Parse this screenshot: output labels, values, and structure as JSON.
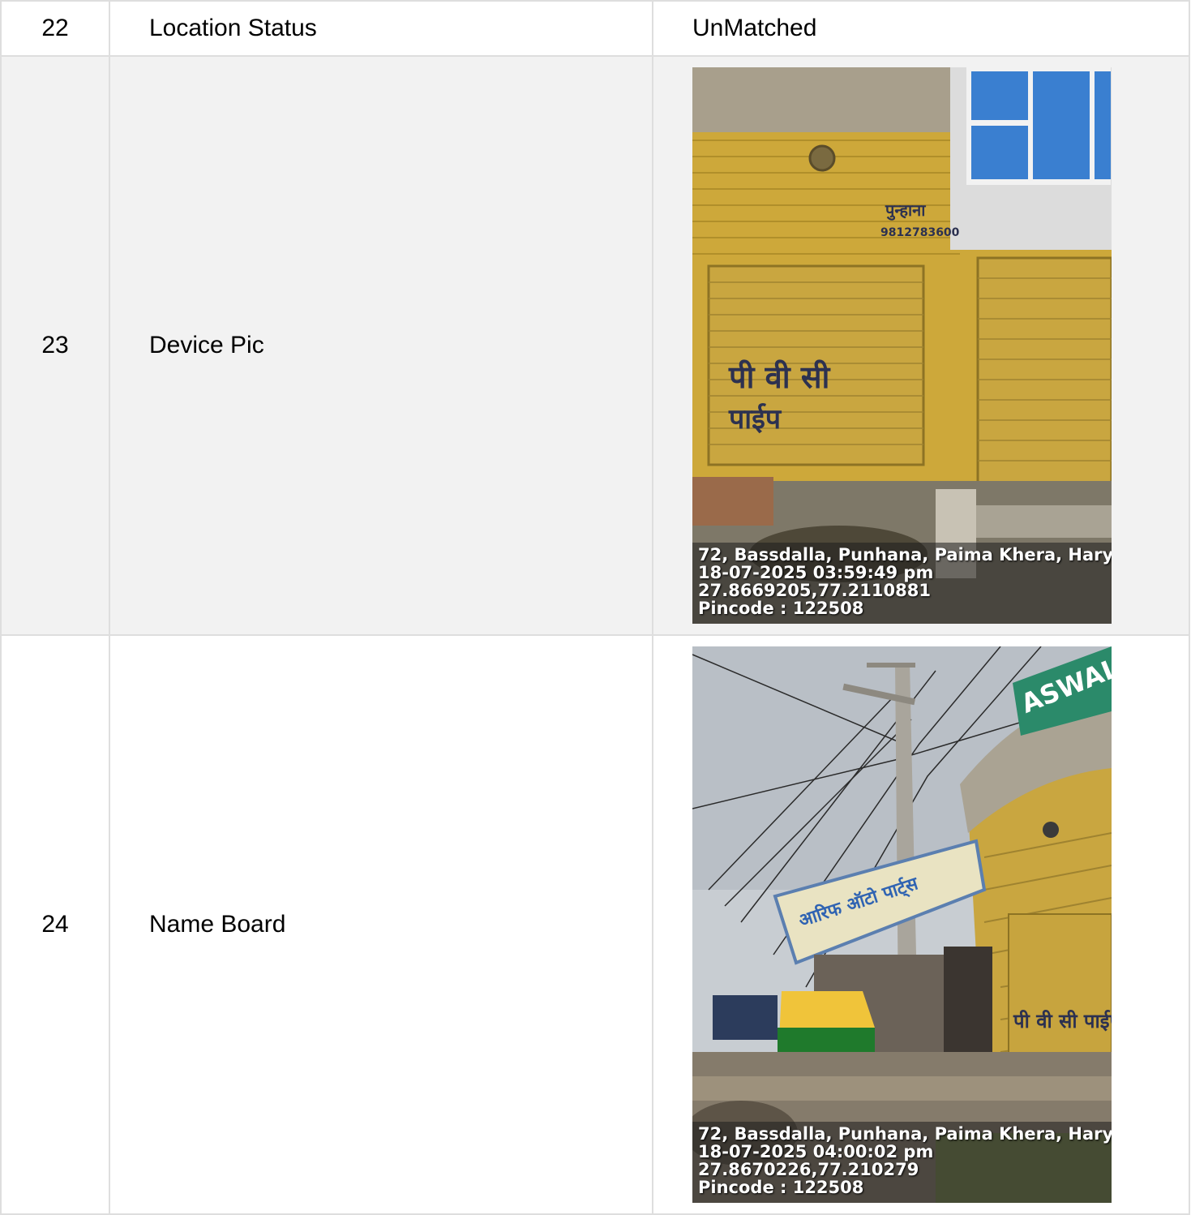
{
  "rows": [
    {
      "num": "22",
      "label": "Location Status",
      "value": "UnMatched"
    },
    {
      "num": "23",
      "label": "Device Pic"
    },
    {
      "num": "24",
      "label": "Name Board"
    }
  ],
  "photos": {
    "device": {
      "address": "72, Bassdalla, Punhana, Paima Khera, Hary",
      "datetime": "18-07-2025 03:59:49 pm",
      "coords": "27.8669205,77.2110881",
      "pincode": "Pincode : 122508",
      "shutter_text_1": "पी वी सी",
      "shutter_text_2": "पाईप",
      "wall_text": "पुन्हाना",
      "wall_phone": "9812783600"
    },
    "board": {
      "address": "72, Bassdalla, Punhana, Paima Khera, Hary",
      "datetime": "18-07-2025 04:00:02 pm",
      "coords": "27.8670226,77.210279",
      "pincode": "Pincode : 122508",
      "sign_text": "आरिफ ऑटो पार्ट्स",
      "shop_sign": "ASWAL",
      "shutter_text": "पी वी सी पाईप फिटि"
    }
  },
  "colors": {
    "border": "#dedede",
    "shaded_row": "#f2f2f2",
    "wall_yellow": "#d8b23c"
  }
}
